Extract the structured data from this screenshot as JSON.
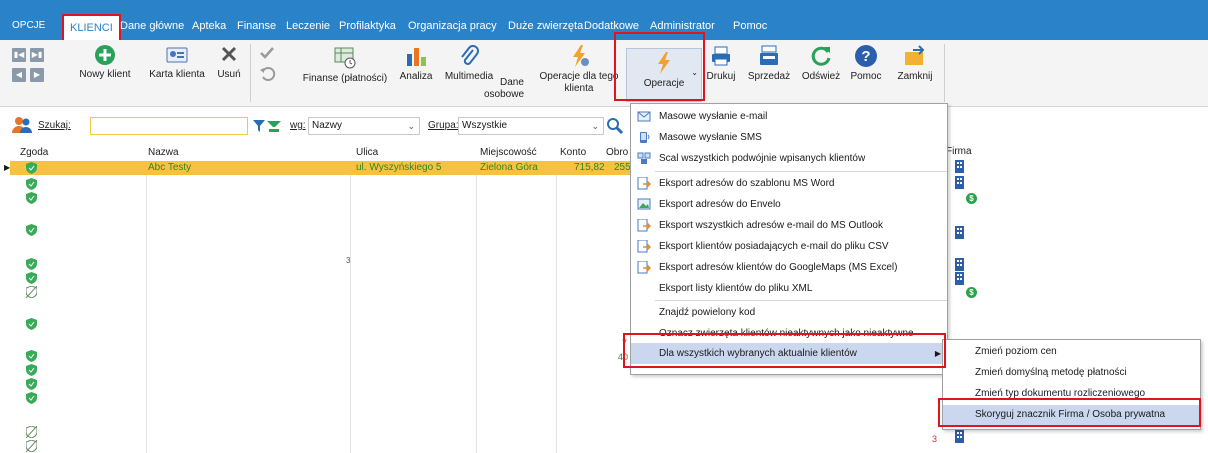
{
  "menu": {
    "opcje": "OPCJE",
    "items": [
      "KLIENCI",
      "Dane główne",
      "Apteka",
      "Finanse",
      "Leczenie",
      "Profilaktyka",
      "Organizacja pracy",
      "Duże zwierzęta",
      "Dodatkowe",
      "Administrator",
      "Pomoc"
    ]
  },
  "ribbon": {
    "new_client": "Nowy klient",
    "client_card": "Karta klienta",
    "delete": "Usuń",
    "finance": "Finanse (płatności)",
    "analysis": "Analiza",
    "multimedia": "Multimedia",
    "personal_data_1": "Dane",
    "personal_data_2": "osobowe",
    "ops_for_1": "Operacje dla tego",
    "ops_for_2": "klienta",
    "operations": "Operacje",
    "print": "Drukuj",
    "sale": "Sprzedaż",
    "refresh": "Odśwież",
    "help": "Pomoc",
    "close": "Zamknij"
  },
  "search": {
    "label": "Szukaj:",
    "value": "",
    "by_label": "wg:",
    "by_value": "Nazwy",
    "group_label": "Grupa:",
    "group_value": "Wszystkie"
  },
  "grid": {
    "columns": [
      "Zgoda",
      "Nazwa",
      "Ulica",
      "Miejscowość",
      "Konto",
      "Obro",
      "Firma"
    ],
    "rows": [
      {
        "nazwa": "Abc Testy",
        "ulica": "ul. Wyszyńskiego 5",
        "miejscowosc": "Zielona Góra",
        "konto": "715,82",
        "obrot": "255"
      }
    ],
    "stray": [
      "3",
      "7",
      "40",
      "3"
    ]
  },
  "dropdown": {
    "items": [
      "Masowe wysłanie e-mail",
      "Masowe wysłanie SMS",
      "Scal wszystkich podwójnie wpisanych klientów",
      "Eksport adresów do szablonu MS Word",
      "Eksport adresów do Envelo",
      "Eksport wszystkich adresów e-mail do MS Outlook",
      "Eksport klientów posiadających e-mail do pliku CSV",
      "Eksport adresów klientów do GoogleMaps (MS Excel)",
      "Eksport listy klientów do pliku XML",
      "Znajdź powielony kod",
      "Oznacz zwierzęta klientów nieaktywnych jako nieaktywne",
      "Dla wszystkich wybranych aktualnie klientów"
    ]
  },
  "submenu": {
    "items": [
      "Zmień poziom cen",
      "Zmień domyślną metodę płatności",
      "Zmień typ dokumentu rozliczeniowego",
      "Skoryguj znacznik Firma / Osoba prywatna"
    ]
  },
  "colors": {
    "menubar": "#2a83c9",
    "highlight_row": "#f7c244",
    "menu_hover": "#cad7ee",
    "annotation_red": "#e0141e",
    "green_text": "#2a8a26"
  }
}
